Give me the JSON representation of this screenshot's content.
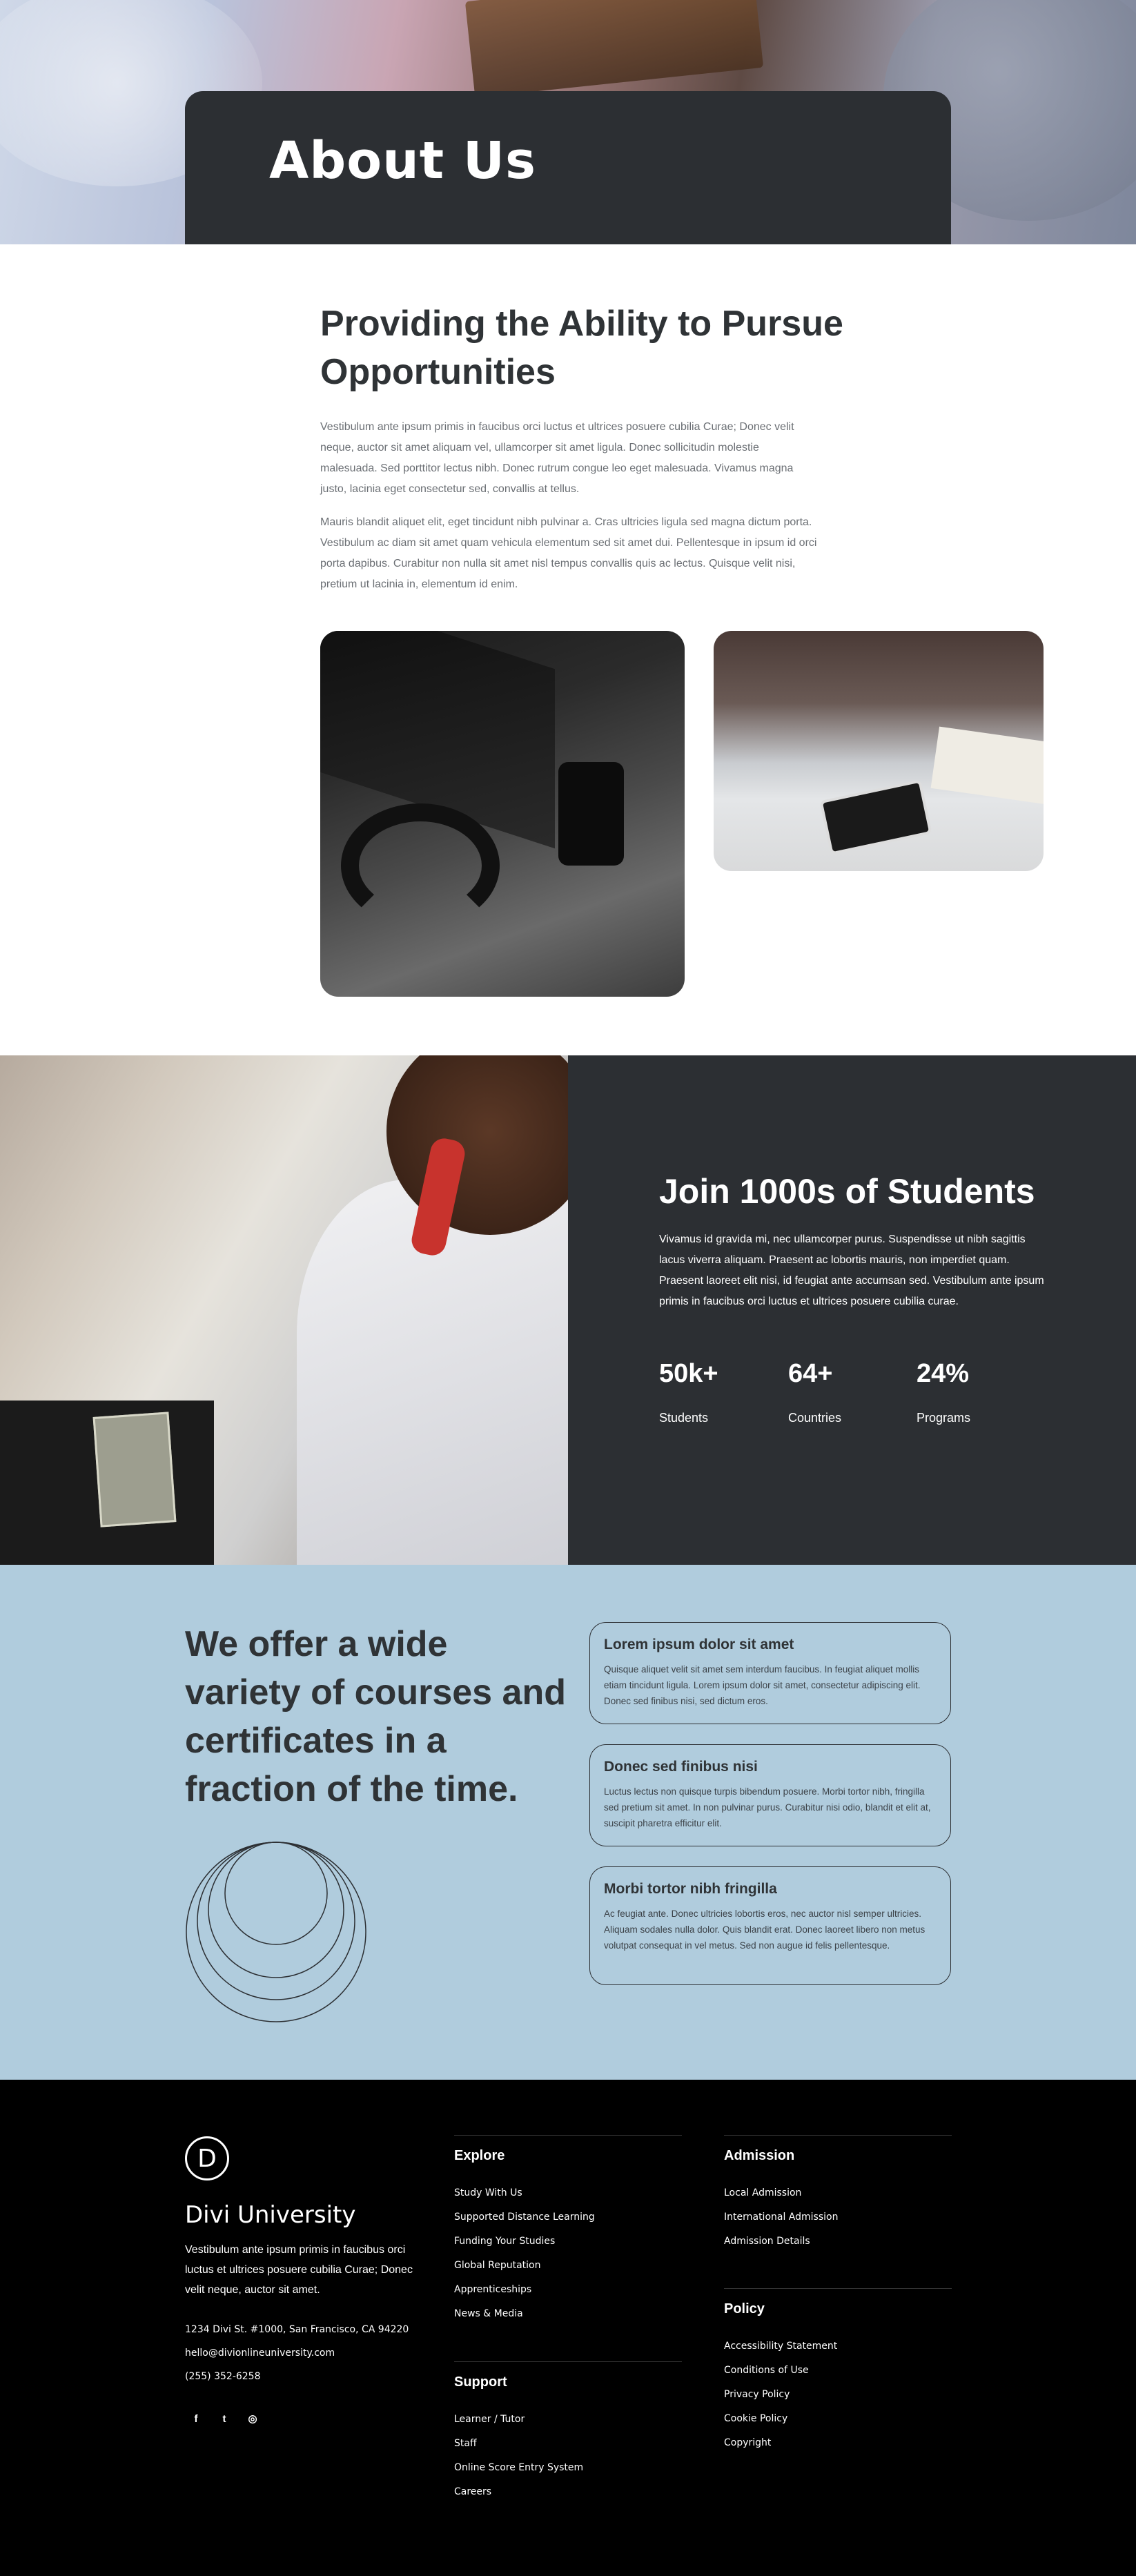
{
  "hero": {
    "title": "About Us"
  },
  "intro": {
    "heading": "Providing the Ability to Pursue Opportunities",
    "paragraph1": "Vestibulum ante ipsum primis in faucibus orci luctus et ultrices posuere cubilia Curae; Donec velit neque, auctor sit amet aliquam vel, ullamcorper sit amet ligula. Donec sollicitudin molestie malesuada. Sed porttitor lectus nibh. Donec rutrum congue leo eget malesuada. Vivamus magna justo, lacinia eget consectetur sed, convallis at tellus.",
    "paragraph2": "Mauris blandit aliquet elit, eget tincidunt nibh pulvinar a. Cras ultricies ligula sed magna dictum porta. Vestibulum ac diam sit amet quam vehicula elementum sed sit amet dui. Pellentesque in ipsum id orci porta dapibus. Curabitur non nulla sit amet nisl tempus convallis quis ac lectus. Quisque velit nisi, pretium ut lacinia in, elementum id enim."
  },
  "stats": {
    "heading": "Join 1000s of Students",
    "text": "Vivamus id gravida mi, nec ullamcorper purus. Suspendisse ut nibh sagittis lacus viverra aliquam. Praesent ac lobortis mauris, non imperdiet quam. Praesent laoreet elit nisi, id feugiat ante accumsan sed. Vestibulum ante ipsum primis in faucibus orci luctus et ultrices posuere cubilia curae.",
    "items": [
      {
        "value": "50k+",
        "label": "Students"
      },
      {
        "value": "64+",
        "label": "Countries"
      },
      {
        "value": "24%",
        "label": "Programs"
      }
    ]
  },
  "courses": {
    "heading": "We offer a wide variety of courses and certificates in a fraction of the time.",
    "cards": [
      {
        "title": "Lorem ipsum dolor sit amet",
        "body": "Quisque aliquet velit sit amet sem interdum faucibus. In feugiat aliquet mollis etiam tincidunt ligula. Lorem ipsum dolor sit amet, consectetur adipiscing elit. Donec sed finibus nisi, sed dictum eros."
      },
      {
        "title": "Donec sed finibus nisi",
        "body": "Luctus lectus non quisque turpis bibendum posuere. Morbi tortor nibh, fringilla sed pretium sit amet. In non pulvinar purus. Curabitur nisi odio, blandit et elit at, suscipit pharetra efficitur elit."
      },
      {
        "title": "Morbi tortor nibh fringilla",
        "body": "Ac feugiat ante. Donec ultricies lobortis eros, nec auctor nisl semper ultricies. Aliquam sodales nulla dolor. Quis blandit erat. Donec laoreet libero non metus volutpat consequat in vel metus. Sed non augue id felis pellentesque."
      }
    ]
  },
  "footer": {
    "logo_letter": "D",
    "brand": "Divi University",
    "description": "Vestibulum ante ipsum primis in faucibus orci luctus et ultrices posuere cubilia Curae; Donec velit neque, auctor sit amet.",
    "address": "1234 Divi St. #1000, San Francisco, CA 94220",
    "email": "hello@divionlineuniversity.com",
    "phone": "(255) 352-6258",
    "social": {
      "facebook": "f",
      "twitter": "t",
      "instagram": "◎"
    },
    "explore": {
      "title": "Explore",
      "links": [
        "Study With Us",
        "Supported Distance Learning",
        "Funding Your Studies",
        "Global Reputation",
        "Apprenticeships",
        "News & Media"
      ]
    },
    "support": {
      "title": "Support",
      "links": [
        "Learner / Tutor",
        "Staff",
        "Online Score Entry System",
        "Careers"
      ]
    },
    "admission": {
      "title": "Admission",
      "links": [
        "Local Admission",
        "International Admission",
        "Admission Details"
      ]
    },
    "policy": {
      "title": "Policy",
      "links": [
        "Accessibility Statement",
        "Conditions of Use",
        "Privacy Policy",
        "Cookie Policy",
        "Copyright"
      ]
    }
  }
}
